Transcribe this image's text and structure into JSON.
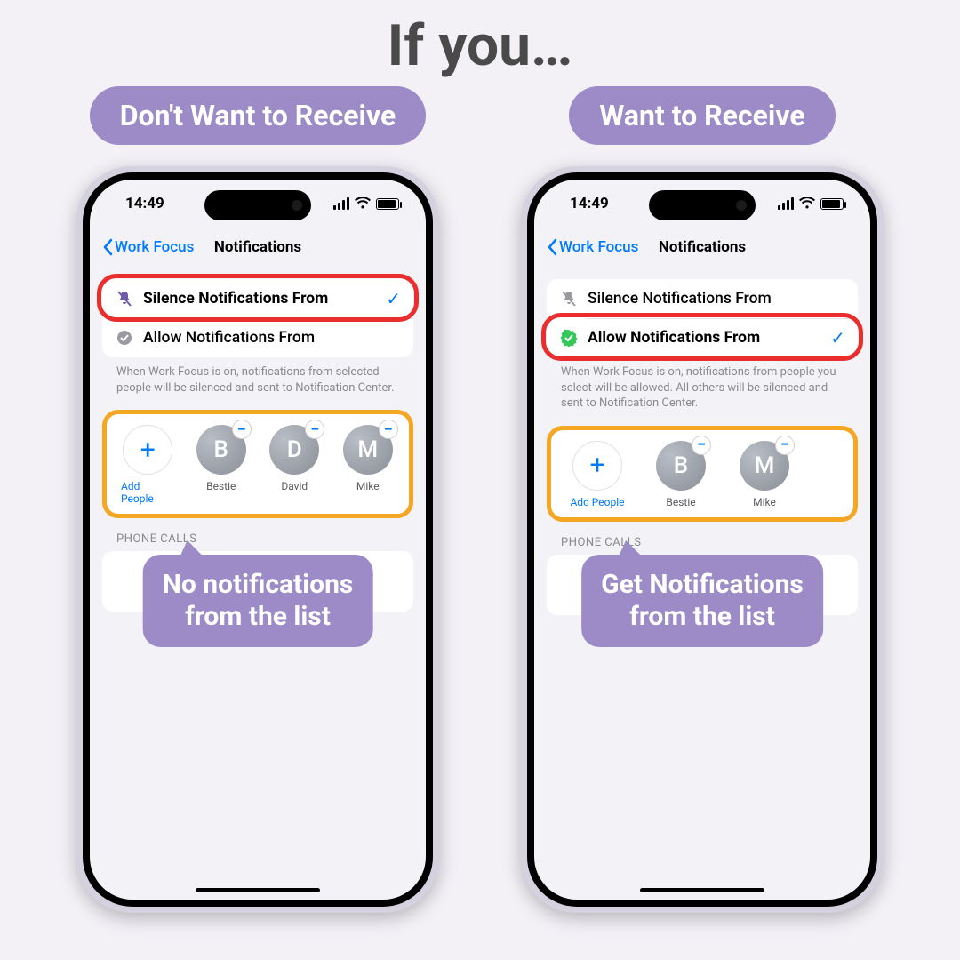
{
  "heading": "If you…",
  "labels": {
    "left_pill": "Don't Want to Receive",
    "right_pill": "Want to Receive"
  },
  "status": {
    "time": "14:49"
  },
  "nav": {
    "back": "Work Focus",
    "title": "Notifications"
  },
  "options": {
    "silence": "Silence Notifications From",
    "allow": "Allow Notifications From"
  },
  "desc": {
    "silence": "When Work Focus is on, notifications from selected people will be silenced and sent to Notification Center.",
    "allow": "When Work Focus is on, notifications from people you select will be allowed. All others will be silenced and sent to Notification Center."
  },
  "people": {
    "add": "Add People",
    "left": [
      {
        "initial": "B",
        "name": "Bestie"
      },
      {
        "initial": "D",
        "name": "David"
      },
      {
        "initial": "M",
        "name": "Mike"
      }
    ],
    "right": [
      {
        "initial": "B",
        "name": "Bestie"
      },
      {
        "initial": "M",
        "name": "Mike"
      }
    ]
  },
  "section": "PHONE CALLS",
  "callouts": {
    "left_l1": "No notifications",
    "left_l2": "from the list",
    "right_l1": "Get Notifications",
    "right_l2": "from the list"
  }
}
